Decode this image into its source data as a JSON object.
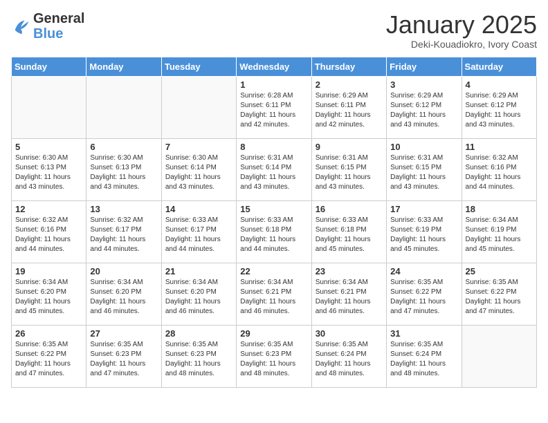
{
  "header": {
    "logo_general": "General",
    "logo_blue": "Blue",
    "title": "January 2025",
    "subtitle": "Deki-Kouadiokro, Ivory Coast"
  },
  "weekdays": [
    "Sunday",
    "Monday",
    "Tuesday",
    "Wednesday",
    "Thursday",
    "Friday",
    "Saturday"
  ],
  "weeks": [
    [
      {
        "day": "",
        "info": ""
      },
      {
        "day": "",
        "info": ""
      },
      {
        "day": "",
        "info": ""
      },
      {
        "day": "1",
        "info": "Sunrise: 6:28 AM\nSunset: 6:11 PM\nDaylight: 11 hours\nand 42 minutes."
      },
      {
        "day": "2",
        "info": "Sunrise: 6:29 AM\nSunset: 6:11 PM\nDaylight: 11 hours\nand 42 minutes."
      },
      {
        "day": "3",
        "info": "Sunrise: 6:29 AM\nSunset: 6:12 PM\nDaylight: 11 hours\nand 43 minutes."
      },
      {
        "day": "4",
        "info": "Sunrise: 6:29 AM\nSunset: 6:12 PM\nDaylight: 11 hours\nand 43 minutes."
      }
    ],
    [
      {
        "day": "5",
        "info": "Sunrise: 6:30 AM\nSunset: 6:13 PM\nDaylight: 11 hours\nand 43 minutes."
      },
      {
        "day": "6",
        "info": "Sunrise: 6:30 AM\nSunset: 6:13 PM\nDaylight: 11 hours\nand 43 minutes."
      },
      {
        "day": "7",
        "info": "Sunrise: 6:30 AM\nSunset: 6:14 PM\nDaylight: 11 hours\nand 43 minutes."
      },
      {
        "day": "8",
        "info": "Sunrise: 6:31 AM\nSunset: 6:14 PM\nDaylight: 11 hours\nand 43 minutes."
      },
      {
        "day": "9",
        "info": "Sunrise: 6:31 AM\nSunset: 6:15 PM\nDaylight: 11 hours\nand 43 minutes."
      },
      {
        "day": "10",
        "info": "Sunrise: 6:31 AM\nSunset: 6:15 PM\nDaylight: 11 hours\nand 43 minutes."
      },
      {
        "day": "11",
        "info": "Sunrise: 6:32 AM\nSunset: 6:16 PM\nDaylight: 11 hours\nand 44 minutes."
      }
    ],
    [
      {
        "day": "12",
        "info": "Sunrise: 6:32 AM\nSunset: 6:16 PM\nDaylight: 11 hours\nand 44 minutes."
      },
      {
        "day": "13",
        "info": "Sunrise: 6:32 AM\nSunset: 6:17 PM\nDaylight: 11 hours\nand 44 minutes."
      },
      {
        "day": "14",
        "info": "Sunrise: 6:33 AM\nSunset: 6:17 PM\nDaylight: 11 hours\nand 44 minutes."
      },
      {
        "day": "15",
        "info": "Sunrise: 6:33 AM\nSunset: 6:18 PM\nDaylight: 11 hours\nand 44 minutes."
      },
      {
        "day": "16",
        "info": "Sunrise: 6:33 AM\nSunset: 6:18 PM\nDaylight: 11 hours\nand 45 minutes."
      },
      {
        "day": "17",
        "info": "Sunrise: 6:33 AM\nSunset: 6:19 PM\nDaylight: 11 hours\nand 45 minutes."
      },
      {
        "day": "18",
        "info": "Sunrise: 6:34 AM\nSunset: 6:19 PM\nDaylight: 11 hours\nand 45 minutes."
      }
    ],
    [
      {
        "day": "19",
        "info": "Sunrise: 6:34 AM\nSunset: 6:20 PM\nDaylight: 11 hours\nand 45 minutes."
      },
      {
        "day": "20",
        "info": "Sunrise: 6:34 AM\nSunset: 6:20 PM\nDaylight: 11 hours\nand 46 minutes."
      },
      {
        "day": "21",
        "info": "Sunrise: 6:34 AM\nSunset: 6:20 PM\nDaylight: 11 hours\nand 46 minutes."
      },
      {
        "day": "22",
        "info": "Sunrise: 6:34 AM\nSunset: 6:21 PM\nDaylight: 11 hours\nand 46 minutes."
      },
      {
        "day": "23",
        "info": "Sunrise: 6:34 AM\nSunset: 6:21 PM\nDaylight: 11 hours\nand 46 minutes."
      },
      {
        "day": "24",
        "info": "Sunrise: 6:35 AM\nSunset: 6:22 PM\nDaylight: 11 hours\nand 47 minutes."
      },
      {
        "day": "25",
        "info": "Sunrise: 6:35 AM\nSunset: 6:22 PM\nDaylight: 11 hours\nand 47 minutes."
      }
    ],
    [
      {
        "day": "26",
        "info": "Sunrise: 6:35 AM\nSunset: 6:22 PM\nDaylight: 11 hours\nand 47 minutes."
      },
      {
        "day": "27",
        "info": "Sunrise: 6:35 AM\nSunset: 6:23 PM\nDaylight: 11 hours\nand 47 minutes."
      },
      {
        "day": "28",
        "info": "Sunrise: 6:35 AM\nSunset: 6:23 PM\nDaylight: 11 hours\nand 48 minutes."
      },
      {
        "day": "29",
        "info": "Sunrise: 6:35 AM\nSunset: 6:23 PM\nDaylight: 11 hours\nand 48 minutes."
      },
      {
        "day": "30",
        "info": "Sunrise: 6:35 AM\nSunset: 6:24 PM\nDaylight: 11 hours\nand 48 minutes."
      },
      {
        "day": "31",
        "info": "Sunrise: 6:35 AM\nSunset: 6:24 PM\nDaylight: 11 hours\nand 48 minutes."
      },
      {
        "day": "",
        "info": ""
      }
    ]
  ]
}
